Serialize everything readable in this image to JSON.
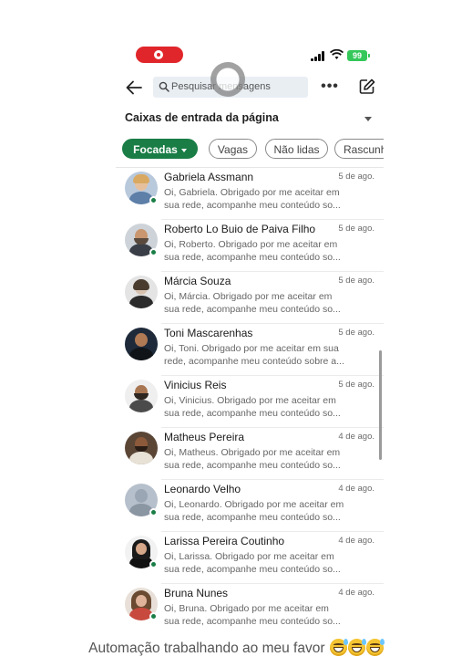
{
  "status_bar": {
    "battery_level": "99"
  },
  "top_nav": {
    "search_placeholder": "Pesquisar mensagens",
    "more_label": "•••"
  },
  "page_inbox": {
    "label": "Caixas de entrada da página"
  },
  "filters": [
    {
      "label": "Focadas",
      "active": true
    },
    {
      "label": "Vagas",
      "active": false
    },
    {
      "label": "Não lidas",
      "active": false
    },
    {
      "label": "Rascunhos",
      "active": false
    }
  ],
  "conversations": [
    {
      "name": "Gabriela Assmann",
      "date": "5 de ago.",
      "preview": "Oi, Gabriela. Obrigado por me aceitar em\nsua rede, acompanhe meu conteúdo so...",
      "online": true
    },
    {
      "name": "Roberto Lo Buio de Paiva Filho",
      "date": "5 de ago.",
      "preview": "Oi, Roberto. Obrigado por me aceitar em\nsua rede, acompanhe meu conteúdo so...",
      "online": true
    },
    {
      "name": "Márcia Souza",
      "date": "5 de ago.",
      "preview": "Oi, Márcia. Obrigado por me aceitar em\nsua rede, acompanhe meu conteúdo so...",
      "online": false
    },
    {
      "name": "Toni Mascarenhas",
      "date": "5 de ago.",
      "preview": "Oi, Toni. Obrigado por me aceitar em sua\nrede, acompanhe meu conteúdo sobre a...",
      "online": false
    },
    {
      "name": "Vinicius Reis",
      "date": "5 de ago.",
      "preview": "Oi, Vinicius. Obrigado por me aceitar em\nsua rede, acompanhe meu conteúdo so...",
      "online": false
    },
    {
      "name": "Matheus Pereira",
      "date": "4 de ago.",
      "preview": "Oi, Matheus. Obrigado por me aceitar em\nsua rede, acompanhe meu conteúdo so...",
      "online": false
    },
    {
      "name": "Leonardo Velho",
      "date": "4 de ago.",
      "preview": "Oi, Leonardo. Obrigado por me aceitar em\nsua rede, acompanhe meu conteúdo so...",
      "online": true
    },
    {
      "name": "Larissa Pereira Coutinho",
      "date": "4 de ago.",
      "preview": "Oi, Larissa. Obrigado por me aceitar em\nsua rede, acompanhe meu conteúdo so...",
      "online": true
    },
    {
      "name": "Bruna Nunes",
      "date": "4 de ago.",
      "preview": "Oi, Bruna. Obrigado por me aceitar em\nsua rede, acompanhe meu conteúdo so...",
      "online": true
    }
  ],
  "caption": {
    "text": "Automação trabalhando ao meu favor",
    "emoji": "sweat-smile-emoji"
  },
  "colors": {
    "accent_green": "#1a7d46",
    "record_red": "#e0262a",
    "battery_green": "#34c759"
  }
}
